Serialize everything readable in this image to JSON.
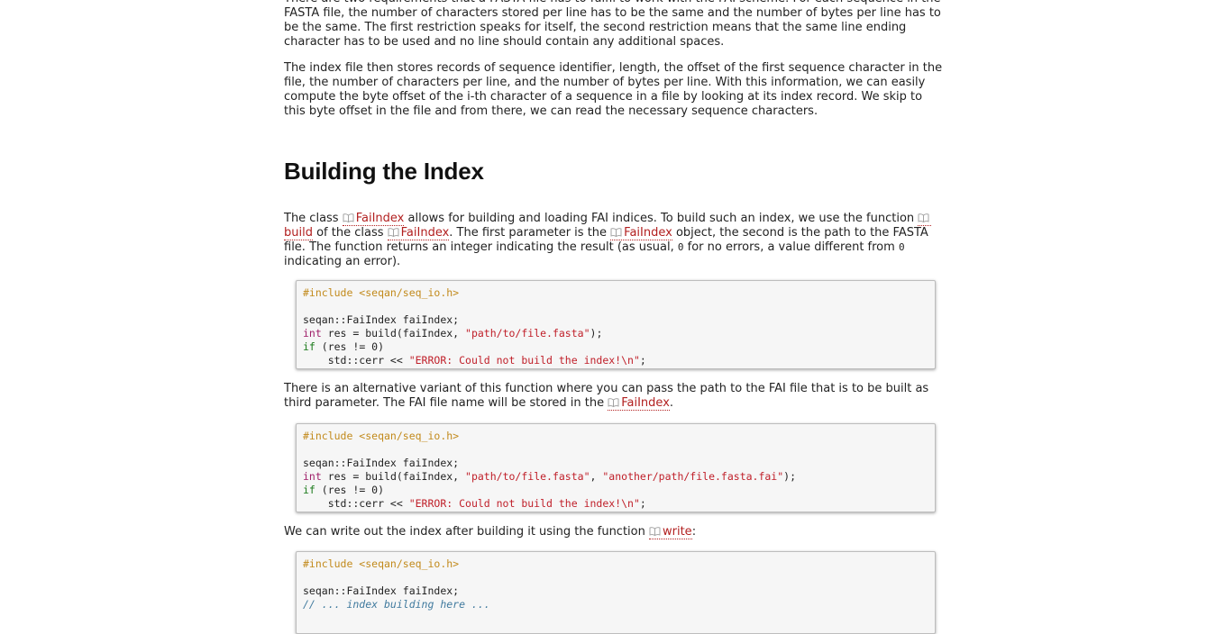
{
  "paragraphs": {
    "req": "There are two requirements that a FASTA file has to fulfil to work with the FAI scheme: For each sequence in the FASTA file, the number of characters stored per line has to be the same and the number of bytes per line has to be the same. The first restriction speaks for itself, the second restriction means that the same line ending character has to be used and no line should contain any additional spaces.",
    "index_file": "The index file then stores records of sequence identifier, length, the offset of the first sequence character in the file, the number of characters per line, and the number of bytes per line. With this information, we can easily compute the byte offset of the i-th character of a sequence in a file by looking at its index record. We skip to this byte offset in the file and from there, we can read the necessary sequence characters."
  },
  "heading": "Building the Index",
  "build_para": {
    "t1": "The class ",
    "link1": "FaiIndex",
    "t2": " allows for building and loading FAI indices. To build such an index, we use the function ",
    "link2": "build",
    "t3": " of the class ",
    "link3": "FaiIndex",
    "t4": ". The first parameter is the ",
    "link4": "FaiIndex",
    "t5": " object, the second is the path to the FASTA file. The function returns an integer indicating the result (as usual, ",
    "zero1": "0",
    "t6": " for no errors, a value different from ",
    "zero2": "0",
    "t7": " indicating an error)."
  },
  "code1": {
    "include": "#include <seqan/seq_io.h>",
    "l2": "seqan::FaiIndex faiIndex;",
    "l3_kw": "int",
    "l3_a": " res = build(faiIndex, ",
    "l3_str": "\"path/to/file.fasta\"",
    "l3_b": ");",
    "l4_kw": "if",
    "l4_a": " (res != 0)",
    "l5_a": "    std::cerr << ",
    "l5_str": "\"ERROR: Could not build the index!\\n\"",
    "l5_b": ";"
  },
  "alt_para": {
    "t1": "There is an alternative variant of this function where you can pass the path to the FAI file that is to be built as third parameter. The FAI file name will be stored in the ",
    "link": "FaiIndex",
    "t2": "."
  },
  "code2": {
    "include": "#include <seqan/seq_io.h>",
    "l2": "seqan::FaiIndex faiIndex;",
    "l3_kw": "int",
    "l3_a": " res = build(faiIndex, ",
    "l3_str1": "\"path/to/file.fasta\"",
    "l3_sep": ", ",
    "l3_str2": "\"another/path/file.fasta.fai\"",
    "l3_b": ");",
    "l4_kw": "if",
    "l4_a": " (res != 0)",
    "l5_a": "    std::cerr << ",
    "l5_str": "\"ERROR: Could not build the index!\\n\"",
    "l5_b": ";"
  },
  "write_para": {
    "t1": "We can write out the index after building it using the function ",
    "link": "write",
    "t2": ":"
  },
  "code3": {
    "include": "#include <seqan/seq_io.h>",
    "l2": "seqan::FaiIndex faiIndex;",
    "l3_comment": "// ... index building here ..."
  },
  "icon": "book-icon",
  "colors": {
    "link": "#b22020",
    "include": "#c28a1c",
    "keyword": "#1a7a1a",
    "string": "#c0202a",
    "comment": "#407a9e",
    "code_bg": "#f6f6f6"
  }
}
